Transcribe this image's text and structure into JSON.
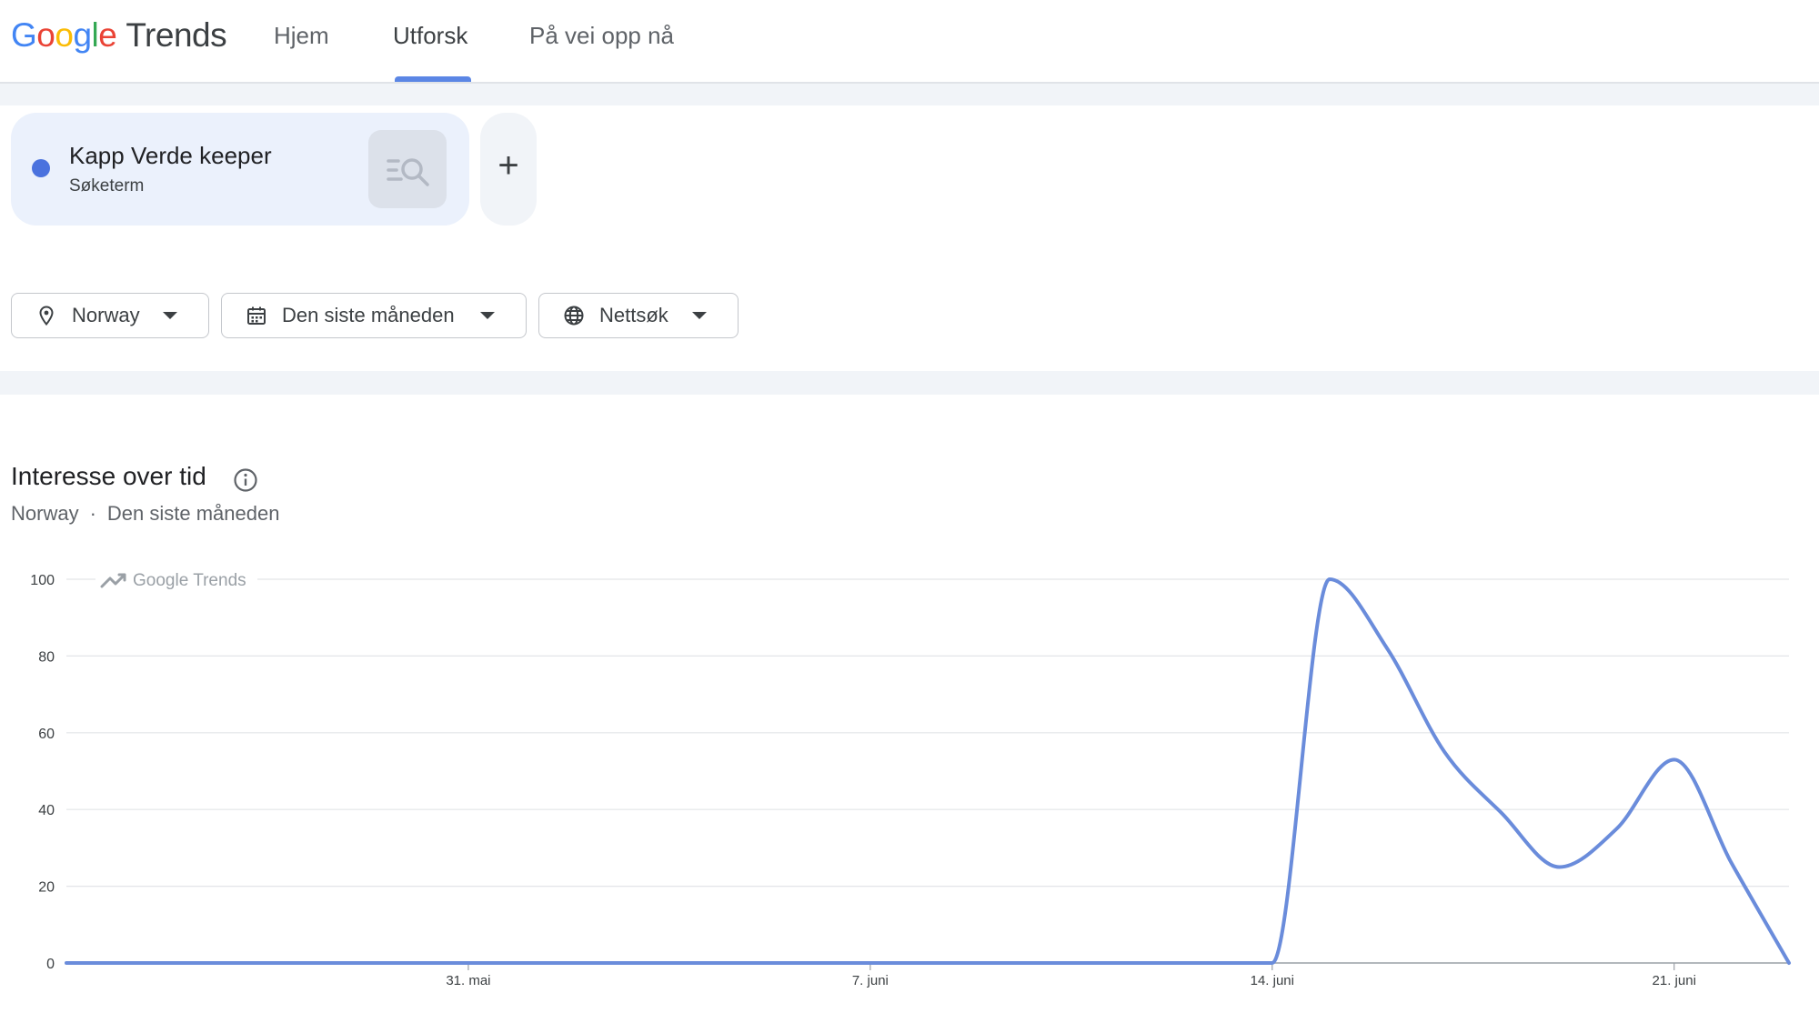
{
  "header": {
    "logo_google": "Google",
    "logo_trends": "Trends",
    "nav": [
      {
        "label": "Hjem",
        "active": false
      },
      {
        "label": "Utforsk",
        "active": true
      },
      {
        "label": "På vei opp nå",
        "active": false
      }
    ]
  },
  "term": {
    "name": "Kapp Verde keeper",
    "type": "Søketerm",
    "color": "#4a72de",
    "search_icon": "search-list-icon",
    "add_label": "+"
  },
  "filters": {
    "location": {
      "label": "Norway",
      "icon": "location-pin-icon"
    },
    "period": {
      "label": "Den siste måneden",
      "icon": "calendar-icon"
    },
    "search_type": {
      "label": "Nettsøk",
      "icon": "globe-icon"
    }
  },
  "section": {
    "title": "Interesse over tid",
    "info_icon": "info-icon",
    "location": "Norway",
    "separator": "·",
    "period": "Den siste måneden"
  },
  "chart_data": {
    "type": "line",
    "watermark": "Google Trends",
    "y_ticks": [
      0,
      20,
      40,
      60,
      80,
      100
    ],
    "ylim": [
      0,
      100
    ],
    "x_ticks": [
      "31. mai",
      "7. juni",
      "14. juni",
      "21. juni"
    ],
    "x_start": "2024-05-24",
    "x_end": "2024-06-23",
    "line_color": "#6a8cdb",
    "grid": true,
    "series": [
      {
        "name": "Kapp Verde keeper",
        "x": [
          "2024-05-24",
          "2024-05-25",
          "2024-05-26",
          "2024-05-27",
          "2024-05-28",
          "2024-05-29",
          "2024-05-30",
          "2024-05-31",
          "2024-06-01",
          "2024-06-02",
          "2024-06-03",
          "2024-06-04",
          "2024-06-05",
          "2024-06-06",
          "2024-06-07",
          "2024-06-08",
          "2024-06-09",
          "2024-06-10",
          "2024-06-11",
          "2024-06-12",
          "2024-06-13",
          "2024-06-14",
          "2024-06-15",
          "2024-06-16",
          "2024-06-17",
          "2024-06-18",
          "2024-06-19",
          "2024-06-20",
          "2024-06-21",
          "2024-06-22",
          "2024-06-23"
        ],
        "values": [
          0,
          0,
          0,
          0,
          0,
          0,
          0,
          0,
          0,
          0,
          0,
          0,
          0,
          0,
          0,
          0,
          0,
          0,
          0,
          0,
          0,
          0,
          100,
          82,
          55,
          39,
          25,
          35,
          53,
          26,
          0
        ]
      }
    ]
  }
}
